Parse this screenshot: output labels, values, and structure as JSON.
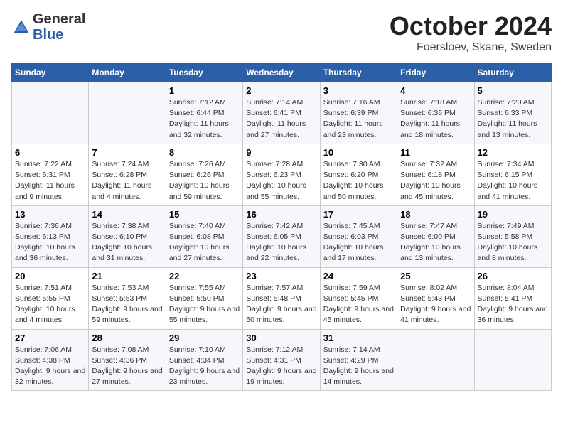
{
  "header": {
    "logo_general": "General",
    "logo_blue": "Blue",
    "title": "October 2024",
    "subtitle": "Foersloev, Skane, Sweden"
  },
  "days_of_week": [
    "Sunday",
    "Monday",
    "Tuesday",
    "Wednesday",
    "Thursday",
    "Friday",
    "Saturday"
  ],
  "weeks": [
    [
      {
        "day": "",
        "sunrise": "",
        "sunset": "",
        "daylight": ""
      },
      {
        "day": "",
        "sunrise": "",
        "sunset": "",
        "daylight": ""
      },
      {
        "day": "1",
        "sunrise": "Sunrise: 7:12 AM",
        "sunset": "Sunset: 6:44 PM",
        "daylight": "Daylight: 11 hours and 32 minutes."
      },
      {
        "day": "2",
        "sunrise": "Sunrise: 7:14 AM",
        "sunset": "Sunset: 6:41 PM",
        "daylight": "Daylight: 11 hours and 27 minutes."
      },
      {
        "day": "3",
        "sunrise": "Sunrise: 7:16 AM",
        "sunset": "Sunset: 6:39 PM",
        "daylight": "Daylight: 11 hours and 23 minutes."
      },
      {
        "day": "4",
        "sunrise": "Sunrise: 7:18 AM",
        "sunset": "Sunset: 6:36 PM",
        "daylight": "Daylight: 11 hours and 18 minutes."
      },
      {
        "day": "5",
        "sunrise": "Sunrise: 7:20 AM",
        "sunset": "Sunset: 6:33 PM",
        "daylight": "Daylight: 11 hours and 13 minutes."
      }
    ],
    [
      {
        "day": "6",
        "sunrise": "Sunrise: 7:22 AM",
        "sunset": "Sunset: 6:31 PM",
        "daylight": "Daylight: 11 hours and 9 minutes."
      },
      {
        "day": "7",
        "sunrise": "Sunrise: 7:24 AM",
        "sunset": "Sunset: 6:28 PM",
        "daylight": "Daylight: 11 hours and 4 minutes."
      },
      {
        "day": "8",
        "sunrise": "Sunrise: 7:26 AM",
        "sunset": "Sunset: 6:26 PM",
        "daylight": "Daylight: 10 hours and 59 minutes."
      },
      {
        "day": "9",
        "sunrise": "Sunrise: 7:28 AM",
        "sunset": "Sunset: 6:23 PM",
        "daylight": "Daylight: 10 hours and 55 minutes."
      },
      {
        "day": "10",
        "sunrise": "Sunrise: 7:30 AM",
        "sunset": "Sunset: 6:20 PM",
        "daylight": "Daylight: 10 hours and 50 minutes."
      },
      {
        "day": "11",
        "sunrise": "Sunrise: 7:32 AM",
        "sunset": "Sunset: 6:18 PM",
        "daylight": "Daylight: 10 hours and 45 minutes."
      },
      {
        "day": "12",
        "sunrise": "Sunrise: 7:34 AM",
        "sunset": "Sunset: 6:15 PM",
        "daylight": "Daylight: 10 hours and 41 minutes."
      }
    ],
    [
      {
        "day": "13",
        "sunrise": "Sunrise: 7:36 AM",
        "sunset": "Sunset: 6:13 PM",
        "daylight": "Daylight: 10 hours and 36 minutes."
      },
      {
        "day": "14",
        "sunrise": "Sunrise: 7:38 AM",
        "sunset": "Sunset: 6:10 PM",
        "daylight": "Daylight: 10 hours and 31 minutes."
      },
      {
        "day": "15",
        "sunrise": "Sunrise: 7:40 AM",
        "sunset": "Sunset: 6:08 PM",
        "daylight": "Daylight: 10 hours and 27 minutes."
      },
      {
        "day": "16",
        "sunrise": "Sunrise: 7:42 AM",
        "sunset": "Sunset: 6:05 PM",
        "daylight": "Daylight: 10 hours and 22 minutes."
      },
      {
        "day": "17",
        "sunrise": "Sunrise: 7:45 AM",
        "sunset": "Sunset: 6:03 PM",
        "daylight": "Daylight: 10 hours and 17 minutes."
      },
      {
        "day": "18",
        "sunrise": "Sunrise: 7:47 AM",
        "sunset": "Sunset: 6:00 PM",
        "daylight": "Daylight: 10 hours and 13 minutes."
      },
      {
        "day": "19",
        "sunrise": "Sunrise: 7:49 AM",
        "sunset": "Sunset: 5:58 PM",
        "daylight": "Daylight: 10 hours and 8 minutes."
      }
    ],
    [
      {
        "day": "20",
        "sunrise": "Sunrise: 7:51 AM",
        "sunset": "Sunset: 5:55 PM",
        "daylight": "Daylight: 10 hours and 4 minutes."
      },
      {
        "day": "21",
        "sunrise": "Sunrise: 7:53 AM",
        "sunset": "Sunset: 5:53 PM",
        "daylight": "Daylight: 9 hours and 59 minutes."
      },
      {
        "day": "22",
        "sunrise": "Sunrise: 7:55 AM",
        "sunset": "Sunset: 5:50 PM",
        "daylight": "Daylight: 9 hours and 55 minutes."
      },
      {
        "day": "23",
        "sunrise": "Sunrise: 7:57 AM",
        "sunset": "Sunset: 5:48 PM",
        "daylight": "Daylight: 9 hours and 50 minutes."
      },
      {
        "day": "24",
        "sunrise": "Sunrise: 7:59 AM",
        "sunset": "Sunset: 5:45 PM",
        "daylight": "Daylight: 9 hours and 45 minutes."
      },
      {
        "day": "25",
        "sunrise": "Sunrise: 8:02 AM",
        "sunset": "Sunset: 5:43 PM",
        "daylight": "Daylight: 9 hours and 41 minutes."
      },
      {
        "day": "26",
        "sunrise": "Sunrise: 8:04 AM",
        "sunset": "Sunset: 5:41 PM",
        "daylight": "Daylight: 9 hours and 36 minutes."
      }
    ],
    [
      {
        "day": "27",
        "sunrise": "Sunrise: 7:06 AM",
        "sunset": "Sunset: 4:38 PM",
        "daylight": "Daylight: 9 hours and 32 minutes."
      },
      {
        "day": "28",
        "sunrise": "Sunrise: 7:08 AM",
        "sunset": "Sunset: 4:36 PM",
        "daylight": "Daylight: 9 hours and 27 minutes."
      },
      {
        "day": "29",
        "sunrise": "Sunrise: 7:10 AM",
        "sunset": "Sunset: 4:34 PM",
        "daylight": "Daylight: 9 hours and 23 minutes."
      },
      {
        "day": "30",
        "sunrise": "Sunrise: 7:12 AM",
        "sunset": "Sunset: 4:31 PM",
        "daylight": "Daylight: 9 hours and 19 minutes."
      },
      {
        "day": "31",
        "sunrise": "Sunrise: 7:14 AM",
        "sunset": "Sunset: 4:29 PM",
        "daylight": "Daylight: 9 hours and 14 minutes."
      },
      {
        "day": "",
        "sunrise": "",
        "sunset": "",
        "daylight": ""
      },
      {
        "day": "",
        "sunrise": "",
        "sunset": "",
        "daylight": ""
      }
    ]
  ]
}
